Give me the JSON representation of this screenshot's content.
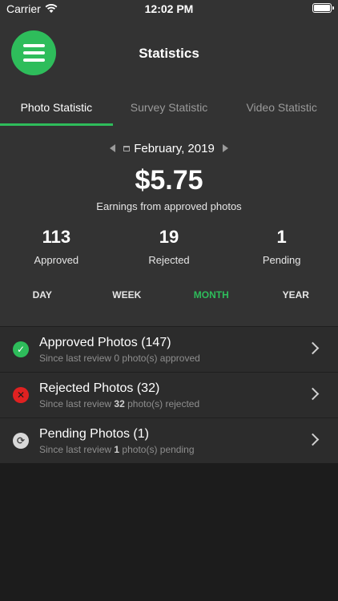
{
  "status_bar": {
    "carrier": "Carrier",
    "time": "12:02 PM"
  },
  "nav": {
    "title": "Statistics"
  },
  "tabs": [
    {
      "label": "Photo Statistic",
      "active": true
    },
    {
      "label": "Survey Statistic",
      "active": false
    },
    {
      "label": "Video Statistic",
      "active": false
    }
  ],
  "date": {
    "label": "February, 2019"
  },
  "earnings": {
    "amount": "$5.75",
    "label": "Earnings from approved photos"
  },
  "stats": [
    {
      "value": "113",
      "label": "Approved"
    },
    {
      "value": "19",
      "label": "Rejected"
    },
    {
      "value": "1",
      "label": "Pending"
    }
  ],
  "periods": [
    {
      "label": "DAY",
      "active": false
    },
    {
      "label": "WEEK",
      "active": false
    },
    {
      "label": "MONTH",
      "active": true
    },
    {
      "label": "YEAR",
      "active": false
    }
  ],
  "list": [
    {
      "title": "Approved Photos (147)",
      "sub_prefix": "Since last review",
      "count": "0",
      "sub_suffix": "photo(s) approved",
      "icon": "check-circle-icon"
    },
    {
      "title": "Rejected Photos (32)",
      "sub_prefix": "Since last review",
      "count": "32",
      "sub_suffix": "photo(s) rejected",
      "icon": "x-circle-icon"
    },
    {
      "title": "Pending Photos (1)",
      "sub_prefix": "Since last review",
      "count": "1",
      "sub_suffix": "photo(s) pending",
      "icon": "refresh-circle-icon"
    }
  ],
  "colors": {
    "accent": "#2ebd5b",
    "reject": "#e02121",
    "background": "#1c1c1c",
    "header": "#333333"
  }
}
